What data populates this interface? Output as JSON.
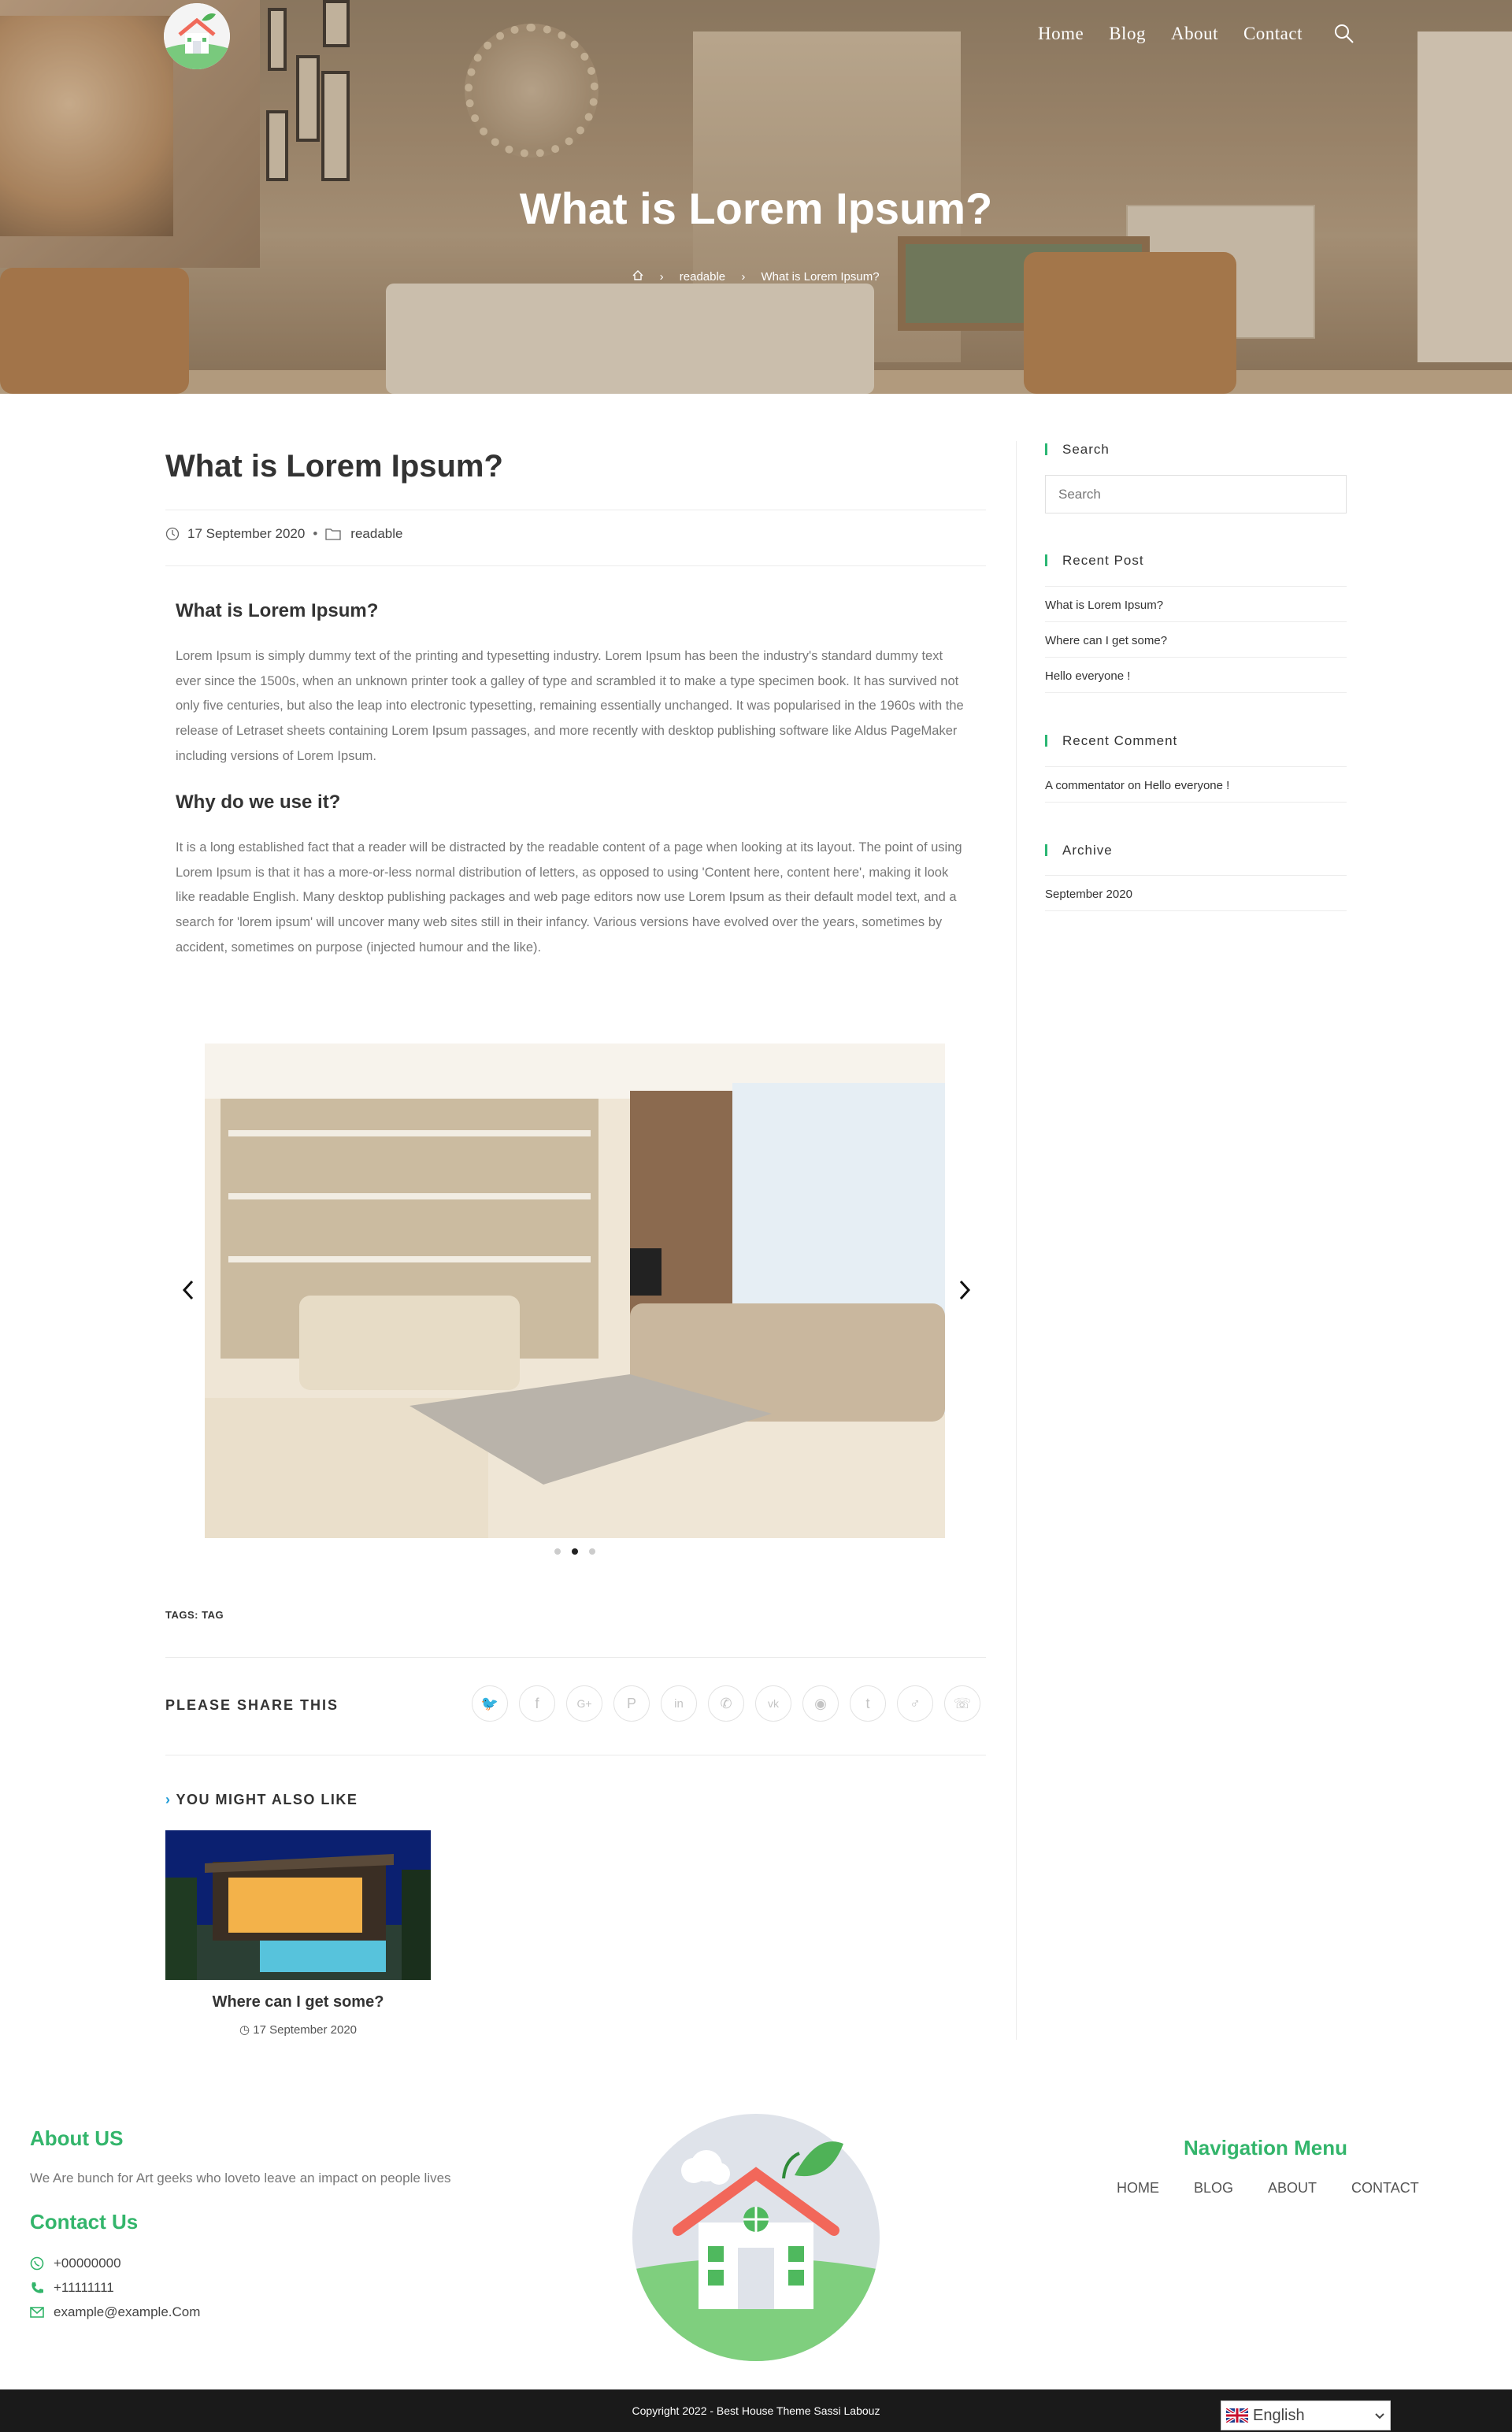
{
  "header": {
    "nav": [
      "Home",
      "Blog",
      "About",
      "Contact"
    ],
    "title": "What is Lorem Ipsum?",
    "breadcrumb": {
      "category": "readable",
      "current": "What is Lorem Ipsum?"
    }
  },
  "post": {
    "title": "What is Lorem Ipsum?",
    "date": "17 September 2020",
    "category": "readable",
    "sections": [
      {
        "heading": "What is Lorem Ipsum?",
        "body": "Lorem Ipsum is simply dummy text of the printing and typesetting industry. Lorem Ipsum has been the industry's standard dummy text ever since the 1500s, when an unknown printer took a galley of type and scrambled it to make a type specimen book. It has survived not only five centuries, but also the leap into electronic typesetting, remaining essentially unchanged. It was popularised in the 1960s with the release of Letraset sheets containing Lorem Ipsum passages, and more recently with desktop publishing software like Aldus PageMaker including versions of Lorem Ipsum."
      },
      {
        "heading": "Why do we use it?",
        "body": "It is a long established fact that a reader will be distracted by the readable content of a page when looking at its layout. The point of using Lorem Ipsum is that it has a more-or-less normal distribution of letters, as opposed to using 'Content here, content here', making it look like readable English. Many desktop publishing packages and web page editors now use Lorem Ipsum as their default model text, and a search for 'lorem ipsum' will uncover many web sites still in their infancy. Various versions have evolved over the years, sometimes by accident, sometimes on purpose (injected humour and the like)."
      }
    ],
    "slider": {
      "slides": 3,
      "active_index": 1
    },
    "tags_label": "TAGS:",
    "tag": "TAG",
    "share_label": "PLEASE SHARE THIS",
    "share_icons": [
      "twitter-icon",
      "facebook-icon",
      "google-plus-icon",
      "pinterest-icon",
      "linkedin-icon",
      "viber-icon",
      "vk-icon",
      "reddit-icon",
      "tumblr-icon",
      "viadeo-icon",
      "whatsapp-icon"
    ],
    "related_heading": "YOU MIGHT ALSO LIKE",
    "related": {
      "title": "Where can I get some?",
      "date": "17 September 2020"
    }
  },
  "sidebar": {
    "search": {
      "title": "Search",
      "placeholder": "Search"
    },
    "recent_post": {
      "title": "Recent Post",
      "items": [
        "What is Lorem Ipsum?",
        "Where can I get some?",
        "Hello everyone !"
      ]
    },
    "recent_comment": {
      "title": "Recent Comment",
      "author": "A commentator",
      "on": "on",
      "post": "Hello everyone !"
    },
    "archive": {
      "title": "Archive",
      "items": [
        "September 2020"
      ]
    }
  },
  "footer": {
    "about_title": "About US",
    "about_text": "We Are bunch for Art geeks who loveto leave an impact on people lives",
    "contact_title": "Contact Us",
    "whatsapp": "+00000000",
    "phone": "+11111111",
    "email": "example@example.Com",
    "nav_title": "Navigation Menu",
    "nav": [
      "HOME",
      "BLOG",
      "ABOUT",
      "CONTACT"
    ],
    "copyright": "Copyright 2022 - Best House Theme Sassi Labouz",
    "language": "English"
  },
  "colors": {
    "accent": "#33b56b",
    "footer_bar": "#1a1a1a"
  }
}
